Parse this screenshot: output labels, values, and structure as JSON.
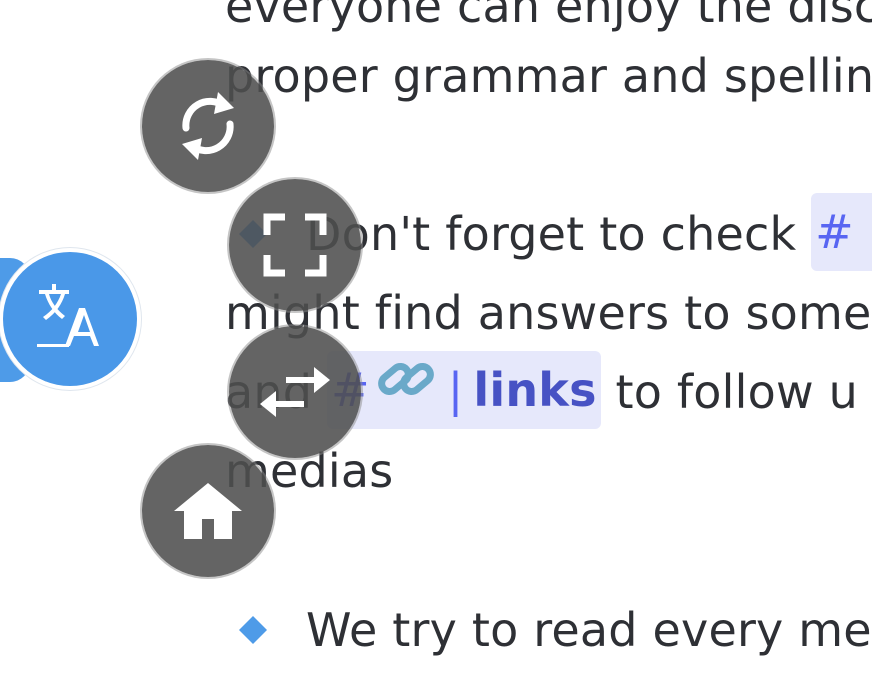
{
  "message": {
    "line1": "everyone can enjoy the disc",
    "line2": "proper grammar and spellin",
    "bullet1_line1_text": "Don't forget to check ",
    "bullet1_channel_hash": "#",
    "bullet1_line2": "might find answers to some",
    "bullet1_line3_prefix": "and ",
    "links_channel": {
      "hash": "#",
      "separator": "|",
      "name": "links"
    },
    "bullet1_line3_suffix": " to follow u",
    "bullet1_line4": "medias",
    "bullet2_text": "We try to read every me"
  },
  "overlay": {
    "buttons": [
      {
        "name": "rotate",
        "icon": "rotate-icon"
      },
      {
        "name": "fullscreen",
        "icon": "fullscreen-icon"
      },
      {
        "name": "swap",
        "icon": "swap-arrows-icon"
      },
      {
        "name": "home",
        "icon": "home-icon"
      }
    ],
    "translate_icon": "translate-icon"
  },
  "colors": {
    "bullet": "#4e9be8",
    "channel_bg": "#e6e8fb",
    "channel_text": "#5865f2",
    "fab_bg": "#4e4e4e",
    "translate_bg": "#4a98e8"
  }
}
